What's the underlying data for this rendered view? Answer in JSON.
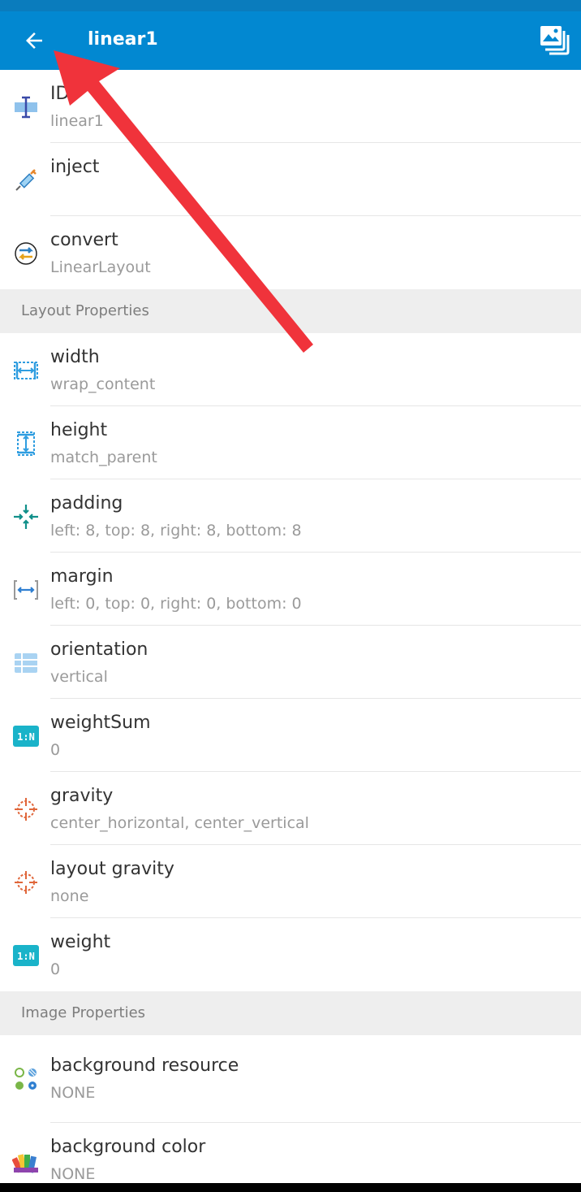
{
  "toolbar": {
    "title": "linear1",
    "back_icon": "arrow-back-icon",
    "gallery_icon": "image-gallery-icon",
    "color": "#0288d1"
  },
  "items_top": [
    {
      "label": "ID",
      "value": "linear1",
      "icon": "text-cursor-icon"
    },
    {
      "label": "inject",
      "value": "",
      "icon": "syringe-icon"
    },
    {
      "label": "convert",
      "value": "LinearLayout",
      "icon": "convert-icon"
    }
  ],
  "sections": {
    "layout": "Layout Properties",
    "image": "Image Properties"
  },
  "layout_items": [
    {
      "label": "width",
      "value": "wrap_content",
      "icon": "width-icon"
    },
    {
      "label": "height",
      "value": "match_parent",
      "icon": "height-icon"
    },
    {
      "label": "padding",
      "value": "left: 8, top: 8, right: 8, bottom: 8",
      "icon": "padding-icon"
    },
    {
      "label": "margin",
      "value": "left: 0, top: 0, right: 0, bottom: 0",
      "icon": "margin-icon"
    },
    {
      "label": "orientation",
      "value": "vertical",
      "icon": "orientation-icon"
    },
    {
      "label": "weightSum",
      "value": "0",
      "icon": "ratio-icon"
    },
    {
      "label": "gravity",
      "value": "center_horizontal, center_vertical",
      "icon": "crosshair-icon"
    },
    {
      "label": "layout gravity",
      "value": "none",
      "icon": "crosshair-icon"
    },
    {
      "label": "weight",
      "value": "0",
      "icon": "ratio-icon"
    }
  ],
  "image_items": [
    {
      "label": "background resource",
      "value": "NONE",
      "icon": "resource-dots-icon"
    },
    {
      "label": "background color",
      "value": "NONE",
      "icon": "color-palette-icon"
    }
  ],
  "ratio_icon_text": "1:N",
  "annotation_color": "#f0333b"
}
